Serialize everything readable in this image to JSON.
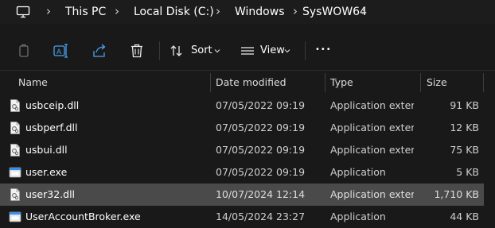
{
  "breadcrumb": {
    "items": [
      "This PC",
      "Local Disk (C:)",
      "Windows",
      "SysWOW64"
    ],
    "separator": "›",
    "root_icon": "monitor-icon"
  },
  "toolbar": {
    "sort_label": "Sort",
    "view_label": "View",
    "more_label": "•••",
    "icons": [
      "copy-icon",
      "rename-icon",
      "share-icon",
      "delete-icon",
      "sort-icon",
      "view-icon",
      "chevron-down-icon",
      "more-icon"
    ]
  },
  "columns": {
    "name": "Name",
    "date": "Date modified",
    "type": "Type",
    "size": "Size"
  },
  "files": [
    {
      "name": "usbceip.dll",
      "date": "07/05/2022 09:19",
      "type": "Application exten...",
      "size": "91 KB",
      "kind": "dll",
      "selected": false
    },
    {
      "name": "usbperf.dll",
      "date": "07/05/2022 09:19",
      "type": "Application exten...",
      "size": "12 KB",
      "kind": "dll",
      "selected": false
    },
    {
      "name": "usbui.dll",
      "date": "07/05/2022 09:19",
      "type": "Application exten...",
      "size": "75 KB",
      "kind": "dll",
      "selected": false
    },
    {
      "name": "user.exe",
      "date": "07/05/2022 09:19",
      "type": "Application",
      "size": "5 KB",
      "kind": "exe",
      "selected": false
    },
    {
      "name": "user32.dll",
      "date": "10/07/2024 12:14",
      "type": "Application exten...",
      "size": "1,710 KB",
      "kind": "dll",
      "selected": true
    },
    {
      "name": "UserAccountBroker.exe",
      "date": "14/05/2024 23:27",
      "type": "Application",
      "size": "44 KB",
      "kind": "exe",
      "selected": false
    }
  ],
  "colors": {
    "background": "#191919",
    "selected_row": "#4a4a4a",
    "exe_icon_blue": "#3a8ee6"
  }
}
